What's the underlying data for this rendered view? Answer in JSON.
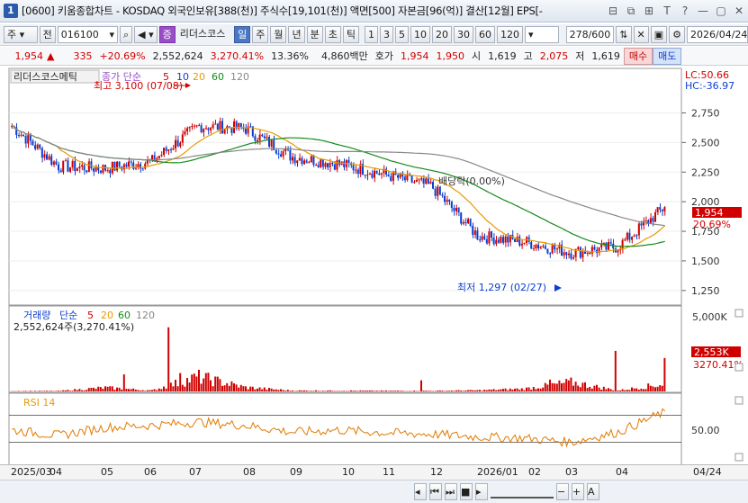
{
  "title": {
    "app_icon": "1",
    "text": "[0600] 키움종합차트 - KOSDAQ 외국인보유[388(천)] 주식수[19,101(천)] 액면[500] 자본금[96(억)] 결산[12월] EPS[-",
    "buttons": [
      "⊟",
      "⧉",
      "⊞",
      "T",
      "?",
      "—",
      "▢",
      "✕"
    ]
  },
  "toolbar": {
    "period_unit": "주",
    "prev_label": "전",
    "code": "016100",
    "indicator_tag": "증",
    "stock_name": "리더스코스",
    "periods": [
      "일",
      "주",
      "월",
      "년",
      "분",
      "초",
      "틱"
    ],
    "period_selected": "일",
    "nums": [
      "1",
      "3",
      "5",
      "10",
      "20",
      "30",
      "60",
      "120"
    ],
    "count": "278",
    "count_total": "/600",
    "date": "2026/04/24"
  },
  "quote": {
    "price": "1,954",
    "arrow": "▲",
    "change": "335",
    "pct": "+20.69%",
    "volume": "2,552,624",
    "vol_pct": "3,270.41%",
    "turnover": "13.36%",
    "amount": "4,860백만",
    "ask_label": "호가",
    "ask": "1,954",
    "bid": "1,950",
    "open_label": "시",
    "open": "1,619",
    "high_label": "고",
    "high": "2,075",
    "low_label": "저",
    "low": "1,619",
    "buy_label": "매수",
    "sell_label": "매도"
  },
  "legend": {
    "name": "리더스코스메틱",
    "ma_label": "종가 단순",
    "ma_periods": [
      "5",
      "10",
      "20",
      "60",
      "120"
    ],
    "ma_colors": [
      "#d10000",
      "#0b3fd1",
      "#e69b00",
      "#138a1a",
      "#888888"
    ],
    "lc": "LC:50.66",
    "hc": "HC:-36.97",
    "high_note": "최고 3,100 (07/08)",
    "low_note": "최저 1,297 (02/27)",
    "dividend_note": "배당락(0.00%)",
    "last_price": "1,954",
    "last_pct": "20.69%"
  },
  "vol_legend": {
    "name": "거래량",
    "ma_label": "단순",
    "ma_periods": [
      "5",
      "20",
      "60",
      "120"
    ],
    "value": "2,552,624주(3,270.41%)",
    "last": "2,553K",
    "last_pct": "3270.41%",
    "axis_top": "5,000K"
  },
  "rsi_legend": {
    "name": "RSI 14",
    "axis": "50.00"
  },
  "x_axis": {
    "labels": [
      "2025/03",
      "04",
      "05",
      "06",
      "07",
      "08",
      "09",
      "10",
      "11",
      "12",
      "2026/01",
      "02",
      "03",
      "04",
      "04/24"
    ]
  },
  "chart_data": [
    {
      "type": "line",
      "title": "리더스코스메틱 일봉",
      "ylim": [
        1150,
        3050
      ],
      "y_ticks": [
        "2,750",
        "2,500",
        "2,250",
        "2,000",
        "1,750",
        "1,500",
        "1,250"
      ],
      "x": [
        "2025/03",
        "04",
        "05",
        "06",
        "07",
        "08",
        "09",
        "10",
        "11",
        "12",
        "2026/01",
        "02",
        "03",
        "04"
      ],
      "series": [
        {
          "name": "종가",
          "values": [
            2640,
            2300,
            2280,
            2340,
            2640,
            2620,
            2380,
            2320,
            2230,
            2130,
            1710,
            1660,
            1570,
            1620,
            1954
          ]
        },
        {
          "name": "MA60",
          "values": [
            2520,
            2440,
            2380,
            2350,
            2420,
            2540,
            2570,
            2520,
            2400,
            2270,
            2090,
            1900,
            1760,
            1640,
            1620
          ]
        },
        {
          "name": "MA120",
          "values": [
            2690,
            2620,
            2550,
            2480,
            2500,
            2560,
            2580,
            2540,
            2450,
            2370,
            2240,
            2120,
            2000,
            1930,
            1860
          ]
        }
      ],
      "annotations": [
        {
          "text": "최고 3,100 (07/08)",
          "value": 3100
        },
        {
          "text": "최저 1,297 (02/27)",
          "value": 1297
        }
      ]
    },
    {
      "type": "bar",
      "title": "거래량",
      "ylim": [
        0,
        5500
      ],
      "y_ticks": [
        "5,000K"
      ],
      "series": [
        {
          "name": "거래량",
          "values": [
            160,
            150,
            1300,
            300,
            4900,
            1400,
            300,
            260,
            220,
            200,
            380,
            900,
            3100,
            300,
            2553
          ]
        }
      ]
    },
    {
      "type": "line",
      "title": "RSI 14",
      "ylim": [
        0,
        100
      ],
      "y_ticks": [
        "50.00"
      ],
      "series": [
        {
          "name": "RSI 14",
          "values": [
            48,
            40,
            52,
            55,
            60,
            55,
            45,
            48,
            44,
            42,
            38,
            36,
            30,
            45,
            75
          ]
        }
      ]
    }
  ]
}
